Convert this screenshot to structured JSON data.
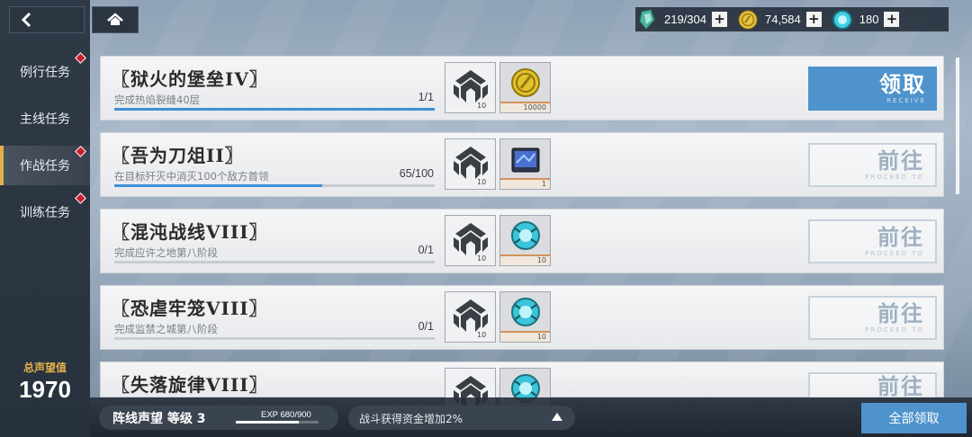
{
  "sidebar": {
    "items": [
      {
        "label": "例行任务",
        "dot": true
      },
      {
        "label": "主线任务",
        "dot": false
      },
      {
        "label": "作战任务",
        "dot": true,
        "active": true
      },
      {
        "label": "训练任务",
        "dot": true
      }
    ],
    "reputation_label": "总声望值",
    "reputation_value": "1970"
  },
  "currency": [
    {
      "icon": "energy-crystal-icon",
      "value": "219/304"
    },
    {
      "icon": "gold-coin-icon",
      "value": "74,584"
    },
    {
      "icon": "cyan-orb-icon",
      "value": "180"
    }
  ],
  "missions": [
    {
      "title": "〖狱火的堡垒IV〗",
      "desc": "完成热焰裂缝40层",
      "progress": "1/1",
      "fill": 1.0,
      "reward1_qty": "10",
      "reward2_icon": "gold-coin-icon",
      "reward2_qty": "10000",
      "action": "领取",
      "action_sub": "RECEIVE",
      "state": "receive"
    },
    {
      "title": "〖吾为刀俎II〗",
      "desc": "在目标歼灭中消灭100个敌方首领",
      "progress": "65/100",
      "fill": 0.65,
      "reward1_qty": "10",
      "reward2_icon": "device-icon",
      "reward2_qty": "1",
      "action": "前往",
      "action_sub": "PROCEED TO",
      "state": "go"
    },
    {
      "title": "〖混沌战线VIII〗",
      "desc": "完成应许之地第八阶段",
      "progress": "0/1",
      "fill": 0,
      "reward1_qty": "10",
      "reward2_icon": "cyan-orb-icon",
      "reward2_qty": "10",
      "action": "前往",
      "action_sub": "PROCEED TO",
      "state": "go"
    },
    {
      "title": "〖恐虐牢笼VIII〗",
      "desc": "完成监禁之城第八阶段",
      "progress": "0/1",
      "fill": 0,
      "reward1_qty": "10",
      "reward2_icon": "cyan-orb-icon",
      "reward2_qty": "10",
      "action": "前往",
      "action_sub": "PROCEED TO",
      "state": "go"
    },
    {
      "title": "〖失落旋律VIII〗",
      "desc": "",
      "progress": "",
      "fill": 0,
      "reward1_qty": "",
      "reward2_icon": "cyan-orb-icon",
      "reward2_qty": "",
      "action": "前往",
      "action_sub": "",
      "state": "go"
    }
  ],
  "bottom": {
    "rep_level": "阵线声望 等级 3",
    "exp": "EXP  680/900",
    "exp_fill": 0.756,
    "bonus": "战斗获得资金增加2%",
    "claim_all": "全部领取"
  }
}
